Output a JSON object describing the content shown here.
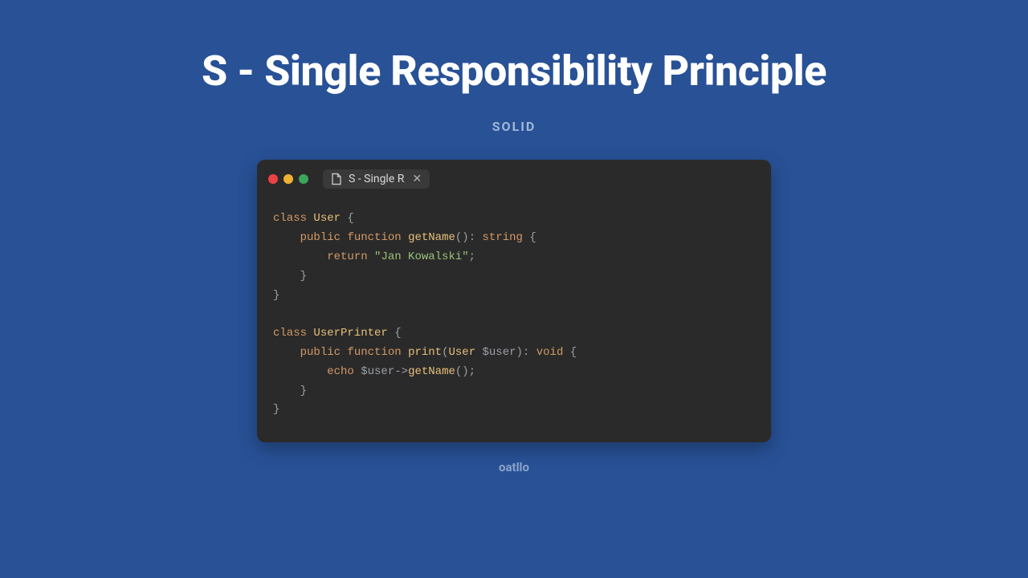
{
  "title": "S - Single Responsibility Principle",
  "subtitle": "SOLID",
  "tab_label": "S - Single R",
  "footer": "oatllo",
  "code": {
    "l1_kw": "class",
    "l1_cls": "User",
    "l1_brace": " {",
    "l2_mod": "public",
    "l2_fnkw": "function",
    "l2_fn": "getName",
    "l2_paren": "()",
    "l2_colon": ": ",
    "l2_type": "string",
    "l2_brace": " {",
    "l3_ret": "return",
    "l3_str": "\"Jan Kowalski\"",
    "l3_semi": ";",
    "l4_brace": "}",
    "l5_brace": "}",
    "l7_kw": "class",
    "l7_cls": "UserPrinter",
    "l7_brace": " {",
    "l8_mod": "public",
    "l8_fnkw": "function",
    "l8_fn": "print",
    "l8_open": "(",
    "l8_ptype": "User",
    "l8_pvar": " $user",
    "l8_close": ")",
    "l8_colon": ": ",
    "l8_type": "void",
    "l8_brace": " {",
    "l9_echo": "echo",
    "l9_var": " $user",
    "l9_arrow": "->",
    "l9_call": "getName",
    "l9_paren": "()",
    "l9_semi": ";",
    "l10_brace": "}",
    "l11_brace": "}"
  }
}
